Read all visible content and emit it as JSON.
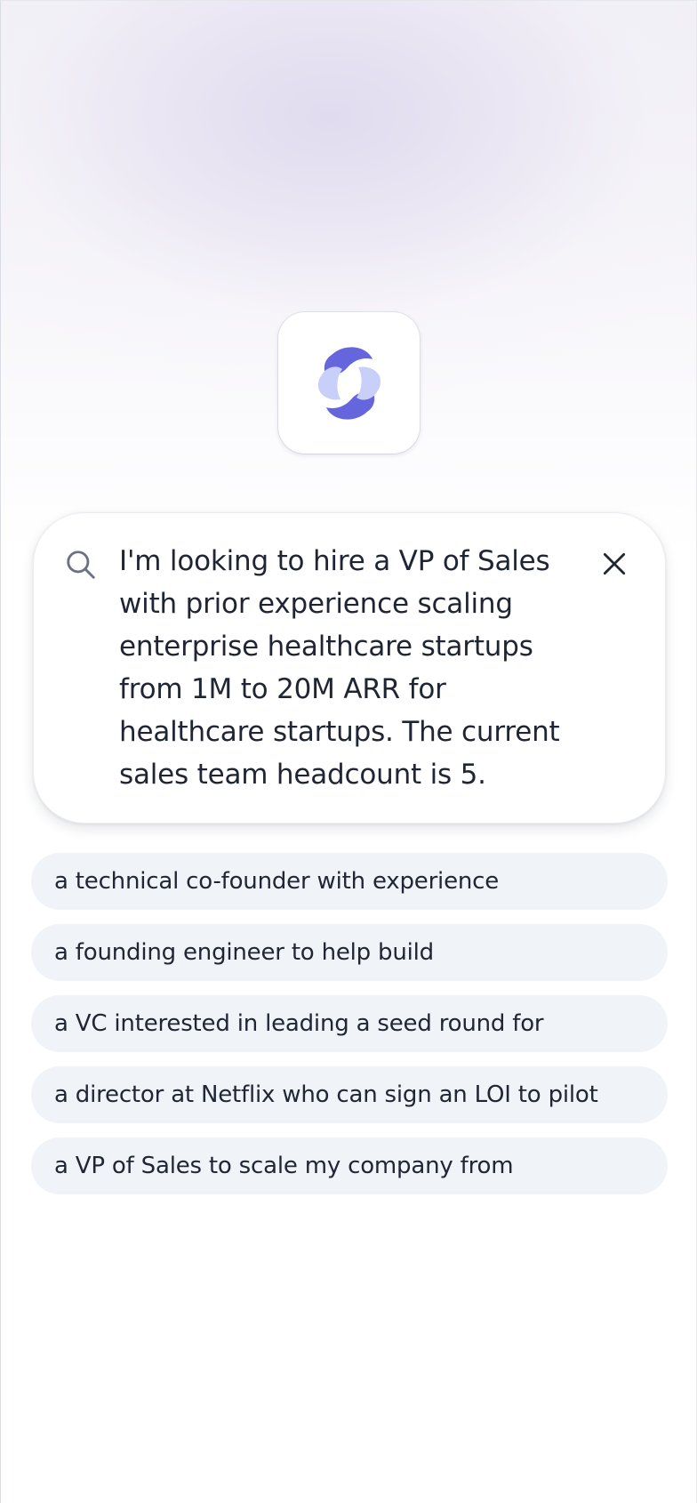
{
  "logo": {
    "icon": "app-logo-icon",
    "colors": {
      "dark": "#6566de",
      "light": "#c8cff8"
    }
  },
  "search": {
    "icon": "search-icon",
    "query": "I'm looking to hire a VP of Sales with prior experience scaling enterprise healthcare startups from 1M to 20M ARR for healthcare startups. The current sales team headcount is 5.",
    "close_icon": "close-icon"
  },
  "suggestions": [
    {
      "label": "a technical co-founder with experience"
    },
    {
      "label": "a founding engineer to help build"
    },
    {
      "label": "a VC interested in leading a seed round for"
    },
    {
      "label": "a director at Netflix who can sign an LOI to pilot"
    },
    {
      "label": "a VP of Sales to scale my company from"
    }
  ],
  "colors": {
    "chip_background": "#f0f3f8",
    "text": "#1f2533",
    "icon": "#6b7280"
  }
}
